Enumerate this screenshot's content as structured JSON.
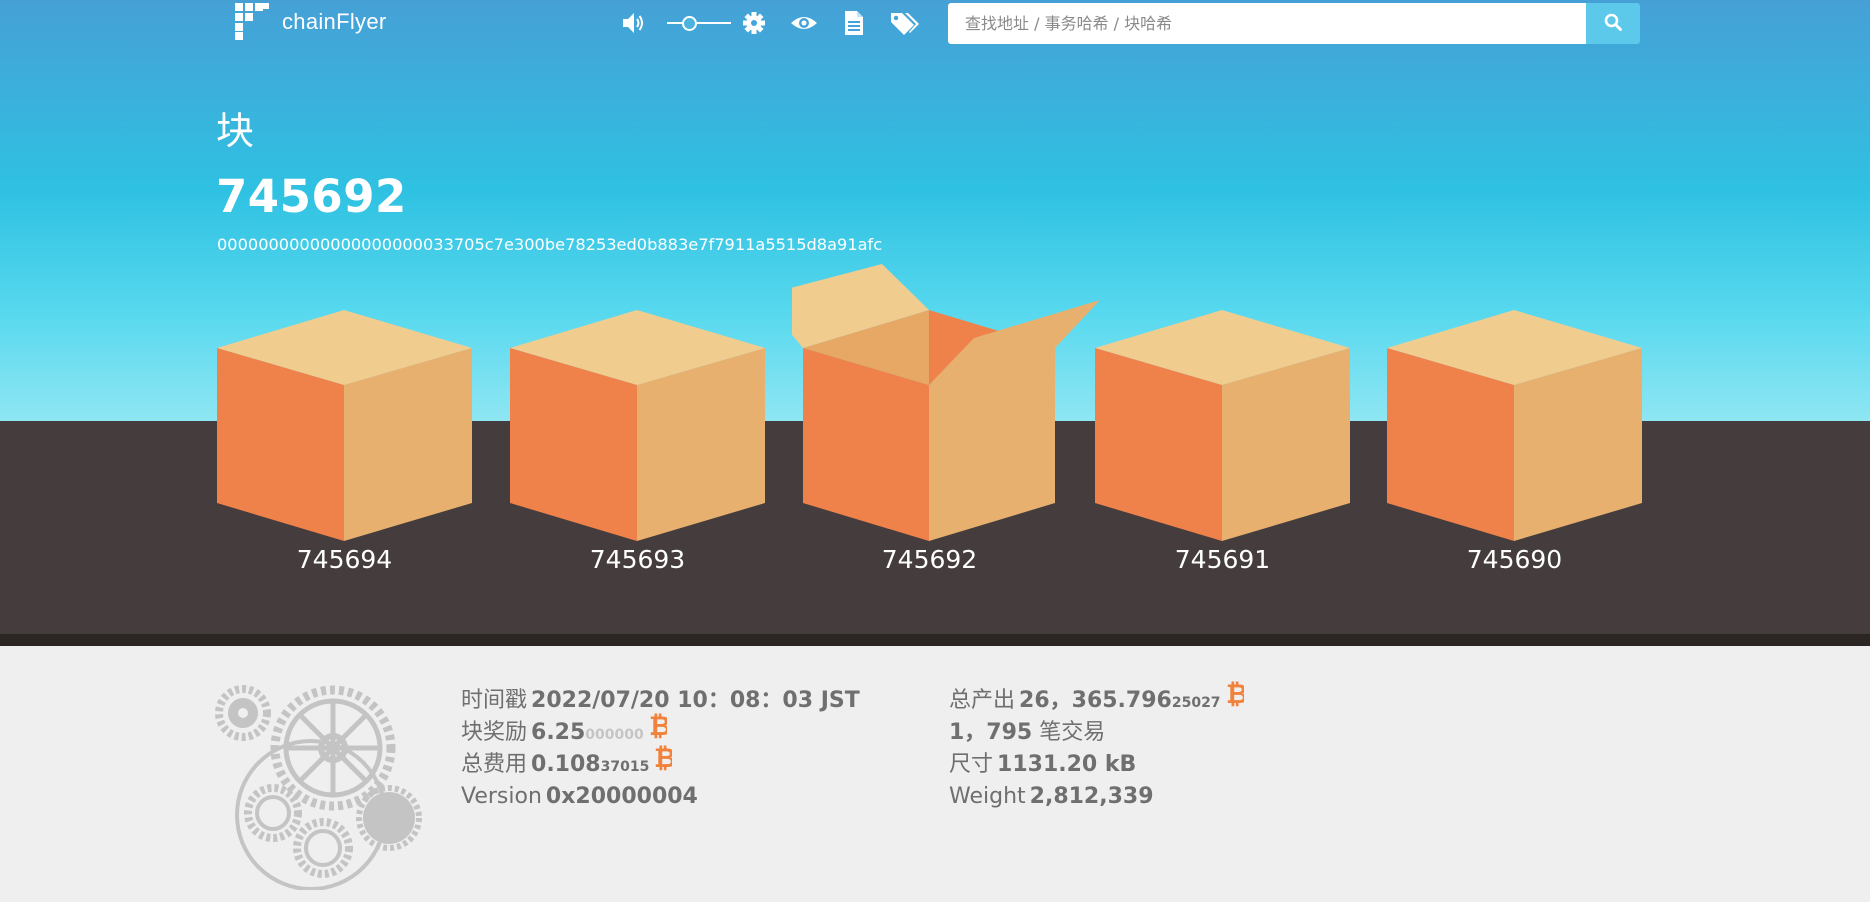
{
  "nav": {
    "brand": "chainFlyer",
    "search_placeholder": "查找地址 / 事务哈希 / 块哈希",
    "volume_level": 0.3,
    "icons": [
      "logo-icon",
      "volume-icon",
      "gear-icon",
      "eye-icon",
      "document-icon",
      "tags-icon",
      "search-icon"
    ]
  },
  "block": {
    "label": "块",
    "number": "745692",
    "hash": "00000000000000000000033705c7e300be78253ed0b883e7f7911a5515d8a91afc"
  },
  "boxes": [
    {
      "number": "745694",
      "open": false
    },
    {
      "number": "745693",
      "open": false
    },
    {
      "number": "745692",
      "open": true
    },
    {
      "number": "745691",
      "open": false
    },
    {
      "number": "745690",
      "open": false
    }
  ],
  "details": {
    "timestamp_label": "时间戳",
    "timestamp_value": "2022/07/20 10：08：03 JST",
    "reward_label": "块奖励",
    "reward_main": "6.25",
    "reward_faint": "000000",
    "fee_label": "总费用",
    "fee_main": "0.108",
    "fee_small": "37015",
    "version_label": "Version",
    "version_value": "0x20000004",
    "output_label": "总产出",
    "output_main": "26，365.796",
    "output_small": "25027",
    "tx_count": "1，795",
    "tx_label": "笔交易",
    "size_label": "尺寸",
    "size_value": "1131.20 kB",
    "weight_label": "Weight",
    "weight_value": "2,812,339"
  },
  "colors": {
    "sky_top": "#46a0d6",
    "sky_bottom": "#8fe6f3",
    "ground": "#453d3d",
    "box_left": "#ef824b",
    "box_right": "#e8b06f",
    "box_top": "#f0cd8f",
    "bitcoin": "#f0823c",
    "gears": "#c4c4c4"
  }
}
